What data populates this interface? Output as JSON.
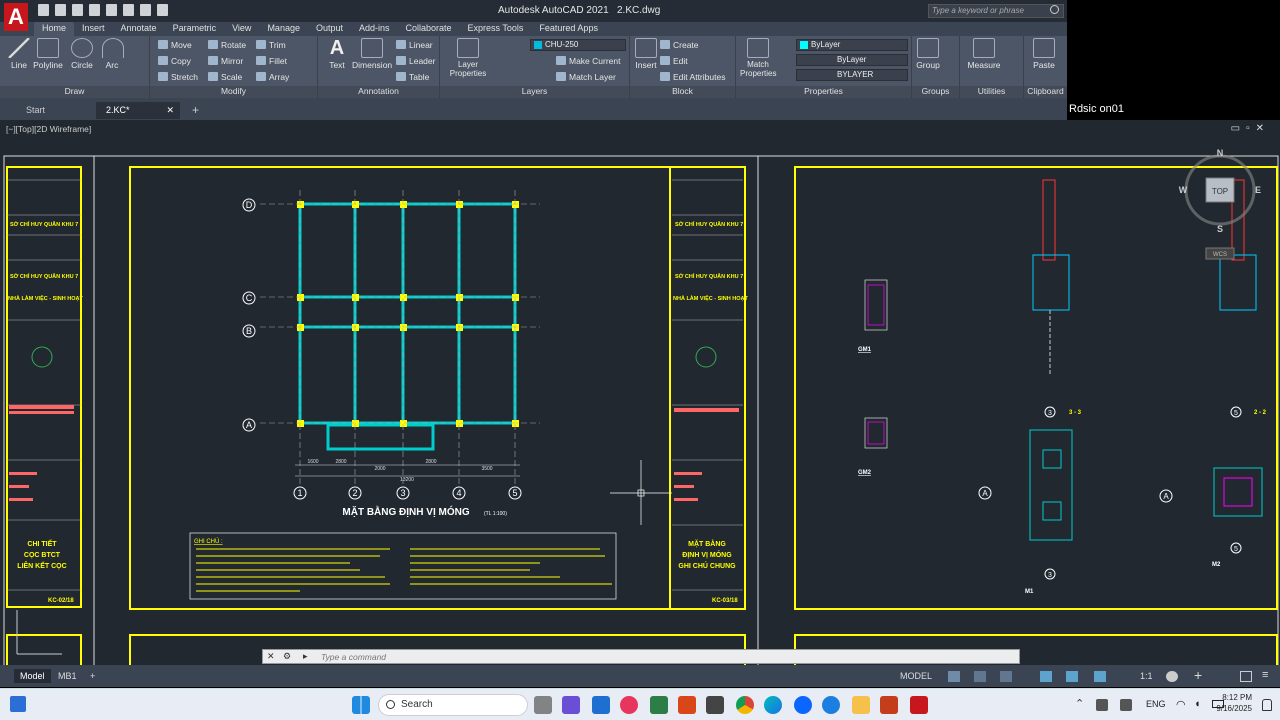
{
  "app": {
    "title": "Autodesk AutoCAD 2021",
    "file": "2.KC.dwg",
    "logo": "A",
    "search_placeholder": "Type a keyword or phrase"
  },
  "ribbon_tabs": [
    "Home",
    "Insert",
    "Annotate",
    "Parametric",
    "View",
    "Manage",
    "Output",
    "Add-ins",
    "Collaborate",
    "Express Tools",
    "Featured Apps"
  ],
  "draw": {
    "line": "Line",
    "polyline": "Polyline",
    "circle": "Circle",
    "arc": "Arc",
    "title": "Draw"
  },
  "modify": {
    "move": "Move",
    "rotate": "Rotate",
    "trim": "Trim",
    "copy": "Copy",
    "mirror": "Mirror",
    "fillet": "Fillet",
    "stretch": "Stretch",
    "scale": "Scale",
    "array": "Array",
    "title": "Modify"
  },
  "annotation": {
    "text": "Text",
    "dimension": "Dimension",
    "linear": "Linear",
    "leader": "Leader",
    "table": "Table",
    "title": "Annotation"
  },
  "layers": {
    "properties": "Layer Properties",
    "current_layer": "CHU-250",
    "make_current": "Make Current",
    "match_layer": "Match Layer",
    "title": "Layers"
  },
  "block": {
    "insert": "Insert",
    "create": "Create",
    "edit": "Edit",
    "edit_attributes": "Edit Attributes",
    "title": "Block"
  },
  "properties": {
    "match": "Match Properties",
    "color": "ByLayer",
    "linetype": "ByLayer",
    "lineweight": "BYLAYER",
    "title": "Properties"
  },
  "groups": {
    "group": "Group",
    "title": "Groups"
  },
  "utilities": {
    "measure": "Measure",
    "title": "Utilities"
  },
  "clipboard": {
    "paste": "Paste",
    "title": "Clipboard"
  },
  "doc_tabs": [
    "Start",
    "2.KC*"
  ],
  "overlay_text": "Rdsic on01",
  "viewport_label": "[−][Top][2D Wireframe]",
  "viewcube": {
    "top": "TOP",
    "n": "N",
    "s": "S",
    "e": "E",
    "w": "W",
    "wcs": "WCS"
  },
  "drawing": {
    "plan_title": "MẶT BẰNG ĐỊNH VỊ MÓNG",
    "plan_scale": "(TL 1:100)",
    "grid_rows": [
      "D",
      "C",
      "B",
      "A"
    ],
    "grid_cols": [
      "1",
      "2",
      "3",
      "4",
      "5"
    ],
    "col_dims": [
      "1600",
      "2800",
      "2000",
      "2800",
      "3500"
    ],
    "total_dim": "13200",
    "notes_title": "GHI CHÚ :",
    "left_sheet": {
      "title": "CHI TIẾT\nCỌC BTCT\nLIÊN KẾT CỌC",
      "code": "KC-02/18"
    },
    "mid_sheet": {
      "title": "MẶT BẰNG\nĐỊNH VỊ MÓNG\nGHI CHÚ CHUNG",
      "code": "KC-03/18"
    },
    "sheet_org": "SỞ CHỈ HUY QUÂN KHU 7",
    "sheet_project": "NHÀ LÀM VIỆC - SINH HOẠT",
    "gm1": "GM1",
    "gm2": "GM2",
    "m1": "M1",
    "m2": "M2",
    "sec33": "3 - 3",
    "sec22": "2 - 2"
  },
  "command_placeholder": "Type a command",
  "layout_tabs": [
    "Model",
    "MB1"
  ],
  "status_model": "MODEL",
  "status_scale": "1:1",
  "taskbar": {
    "search": "Search",
    "lang": "ENG",
    "time": "8:12 PM",
    "date": "9/16/2025"
  }
}
